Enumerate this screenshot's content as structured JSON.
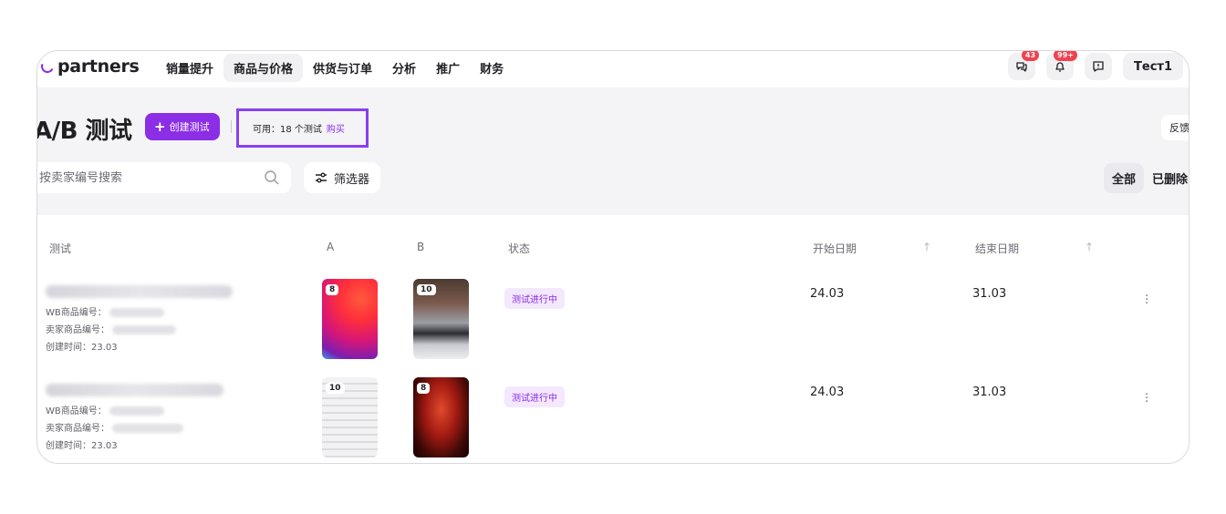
{
  "nav": {
    "logo_text": "partners",
    "items": [
      {
        "label": "销量提升",
        "active": false
      },
      {
        "label": "商品与价格",
        "active": true
      },
      {
        "label": "供货与订单",
        "active": false
      },
      {
        "label": "分析",
        "active": false
      },
      {
        "label": "推广",
        "active": false
      },
      {
        "label": "财务",
        "active": false
      }
    ],
    "chat_badge": "43",
    "bell_badge": "99+",
    "user_label": "Тест1"
  },
  "header": {
    "title": "A/B 测试",
    "create_label": "创建测试",
    "quota_label": "可用：18 个测试",
    "buy_label": "购买",
    "feedback_label": "反馈"
  },
  "toolbar": {
    "search_placeholder": "按卖家编号搜索",
    "filter_label": "筛选器",
    "seg_all": "全部",
    "seg_deleted": "已删除"
  },
  "table": {
    "columns": {
      "test": "测试",
      "a": "A",
      "b": "B",
      "status": "状态",
      "start": "开始日期",
      "end": "结束日期"
    },
    "rows": [
      {
        "wb_label": "WB商品编号：",
        "seller_label": "卖家商品编号：",
        "created": "创建时间：23.03",
        "a_count": "8",
        "b_count": "10",
        "status": "测试进行中",
        "start": "24.03",
        "end": "31.03"
      },
      {
        "wb_label": "WB商品编号：",
        "seller_label": "卖家商品编号：",
        "created": "创建时间：23.03",
        "a_count": "10",
        "b_count": "8",
        "status": "测试进行中",
        "start": "24.03",
        "end": "31.03"
      }
    ]
  },
  "colors": {
    "accent": "#8b2ee6",
    "badge": "#f0424f",
    "status_bg": "#f4e8fd"
  }
}
